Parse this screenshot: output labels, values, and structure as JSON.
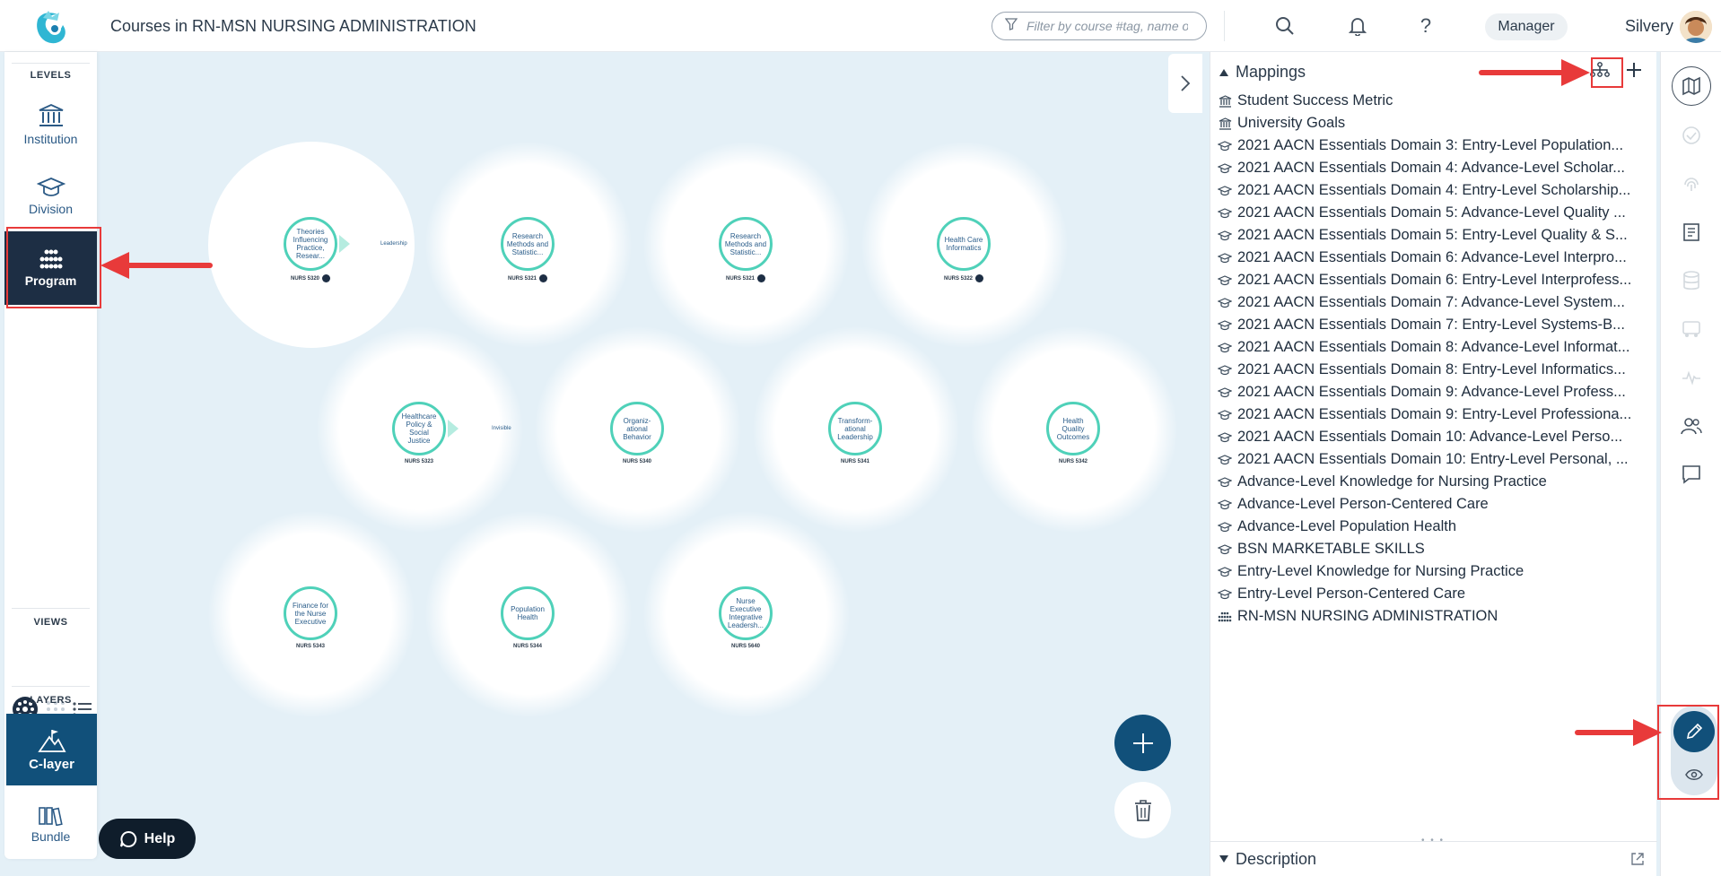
{
  "header": {
    "title": "Courses in RN-MSN NURSING ADMINISTRATION",
    "filter_placeholder": "Filter by course #tag, name or",
    "role": "Manager",
    "user_name": "Silvery"
  },
  "sidebar": {
    "levels_label": "LEVELS",
    "levels": [
      {
        "label": "Institution",
        "icon": "institution-icon"
      },
      {
        "label": "Division",
        "icon": "graduation-cap-icon"
      },
      {
        "label": "Program",
        "icon": "program-dots-icon"
      }
    ],
    "views_label": "VIEWS",
    "layers_label": "LAYERS",
    "clayer_label": "C-layer",
    "bundle_label": "Bundle"
  },
  "help_label": "Help",
  "courses": [
    {
      "name": "Theories Influencing Practice, Resear...",
      "code": "NURS 5320",
      "link": "Leadership"
    },
    {
      "name": "Research Methods and Statistic...",
      "code": "NURS 5321"
    },
    {
      "name": "Research Methods and Statistic...",
      "code": "NURS 5321"
    },
    {
      "name": "Health Care Informatics",
      "code": "NURS 5322"
    },
    {
      "name": "Healthcare Policy & Social Justice",
      "code": "NURS 5323",
      "link": "Invisible"
    },
    {
      "name": "Organiz-ational Behavior",
      "code": "NURS 5340"
    },
    {
      "name": "Transform-ational Leadership",
      "code": "NURS 5341"
    },
    {
      "name": "Health Quality Outcomes",
      "code": "NURS 5342"
    },
    {
      "name": "Finance for the Nurse Executive",
      "code": "NURS 5343"
    },
    {
      "name": "Population Health",
      "code": "NURS 5344"
    },
    {
      "name": "Nurse Executive Integrative Leadersh...",
      "code": "NURS 5640"
    }
  ],
  "panel": {
    "mappings_label": "Mappings",
    "description_label": "Description",
    "mappings": [
      {
        "label": "Student Success Metric",
        "icon": "institution-icon"
      },
      {
        "label": "University Goals",
        "icon": "institution-icon"
      },
      {
        "label": "2021 AACN Essentials Domain 3: Entry-Level Population...",
        "icon": "graduation-cap-icon"
      },
      {
        "label": "2021 AACN Essentials Domain 4: Advance-Level Scholar...",
        "icon": "graduation-cap-icon"
      },
      {
        "label": "2021 AACN Essentials Domain 4: Entry-Level Scholarship...",
        "icon": "graduation-cap-icon"
      },
      {
        "label": "2021 AACN Essentials Domain 5: Advance-Level Quality ...",
        "icon": "graduation-cap-icon"
      },
      {
        "label": "2021 AACN Essentials Domain 5: Entry-Level Quality & S...",
        "icon": "graduation-cap-icon"
      },
      {
        "label": "2021 AACN Essentials Domain 6: Advance-Level Interpro...",
        "icon": "graduation-cap-icon"
      },
      {
        "label": "2021 AACN Essentials Domain 6: Entry-Level Interprofess...",
        "icon": "graduation-cap-icon"
      },
      {
        "label": "2021 AACN Essentials Domain 7: Advance-Level System...",
        "icon": "graduation-cap-icon"
      },
      {
        "label": "2021 AACN Essentials Domain 7: Entry-Level Systems-B...",
        "icon": "graduation-cap-icon"
      },
      {
        "label": "2021 AACN Essentials Domain 8: Advance-Level Informat...",
        "icon": "graduation-cap-icon"
      },
      {
        "label": "2021 AACN Essentials Domain 8: Entry-Level Informatics...",
        "icon": "graduation-cap-icon"
      },
      {
        "label": "2021 AACN Essentials Domain 9: Advance-Level Profess...",
        "icon": "graduation-cap-icon"
      },
      {
        "label": "2021 AACN Essentials Domain 9: Entry-Level Professiona...",
        "icon": "graduation-cap-icon"
      },
      {
        "label": "2021 AACN Essentials Domain 10: Advance-Level Perso...",
        "icon": "graduation-cap-icon"
      },
      {
        "label": "2021 AACN Essentials Domain 10: Entry-Level Personal, ...",
        "icon": "graduation-cap-icon"
      },
      {
        "label": "Advance-Level Knowledge for Nursing Practice",
        "icon": "graduation-cap-icon"
      },
      {
        "label": "Advance-Level Person-Centered Care",
        "icon": "graduation-cap-icon"
      },
      {
        "label": "Advance-Level Population Health",
        "icon": "graduation-cap-icon"
      },
      {
        "label": "BSN MARKETABLE SKILLS",
        "icon": "graduation-cap-icon"
      },
      {
        "label": "Entry-Level Knowledge for Nursing Practice",
        "icon": "graduation-cap-icon"
      },
      {
        "label": "Entry-Level Person-Centered Care",
        "icon": "graduation-cap-icon"
      },
      {
        "label": "RN-MSN NURSING ADMINISTRATION",
        "icon": "program-dots-icon"
      }
    ]
  },
  "colors": {
    "accent": "#11507a",
    "navy": "#1d2e44",
    "ring": "#4fd1b9",
    "canvas": "#e4f0f7",
    "annotation": "#e83a3a"
  }
}
